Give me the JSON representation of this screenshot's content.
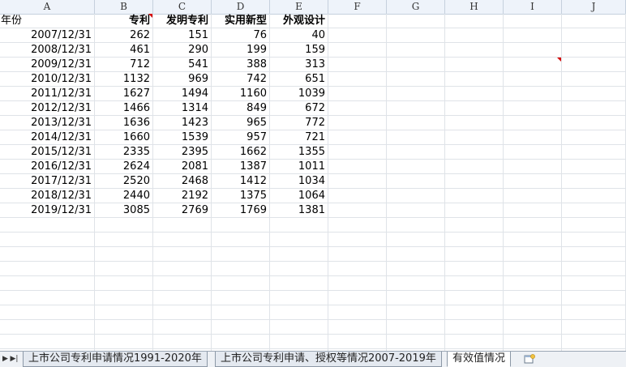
{
  "columns": [
    "A",
    "B",
    "C",
    "D",
    "E",
    "F",
    "G",
    "H",
    "I",
    "J"
  ],
  "header_row": [
    "年份",
    "专利",
    "发明专利",
    "实用新型",
    "外观设计"
  ],
  "rows": [
    [
      "2007/12/31",
      "262",
      "151",
      "76",
      "40"
    ],
    [
      "2008/12/31",
      "461",
      "290",
      "199",
      "159"
    ],
    [
      "2009/12/31",
      "712",
      "541",
      "388",
      "313"
    ],
    [
      "2010/12/31",
      "1132",
      "969",
      "742",
      "651"
    ],
    [
      "2011/12/31",
      "1627",
      "1494",
      "1160",
      "1039"
    ],
    [
      "2012/12/31",
      "1466",
      "1314",
      "849",
      "672"
    ],
    [
      "2013/12/31",
      "1636",
      "1423",
      "965",
      "772"
    ],
    [
      "2014/12/31",
      "1660",
      "1539",
      "957",
      "721"
    ],
    [
      "2015/12/31",
      "2335",
      "2395",
      "1662",
      "1355"
    ],
    [
      "2016/12/31",
      "2624",
      "2081",
      "1387",
      "1011"
    ],
    [
      "2017/12/31",
      "2520",
      "2468",
      "1412",
      "1034"
    ],
    [
      "2018/12/31",
      "2440",
      "2192",
      "1375",
      "1064"
    ],
    [
      "2019/12/31",
      "3085",
      "2769",
      "1769",
      "1381"
    ]
  ],
  "sheet_tabs": [
    {
      "label": "上市公司专利申请情况1991-2020年",
      "active": false
    },
    {
      "label": "上市公司专利申请、授权等情况2007-2019年",
      "active": false
    },
    {
      "label": "有效值情况",
      "active": true
    }
  ],
  "nav_icons": [
    "first-sheet-icon",
    "last-sheet-icon"
  ],
  "new_sheet_icon": "insert-sheet-icon",
  "colors": {
    "comment_marker": "#d40000",
    "grid_line": "#dfe3e8",
    "header_bg": "#eef3fa"
  }
}
